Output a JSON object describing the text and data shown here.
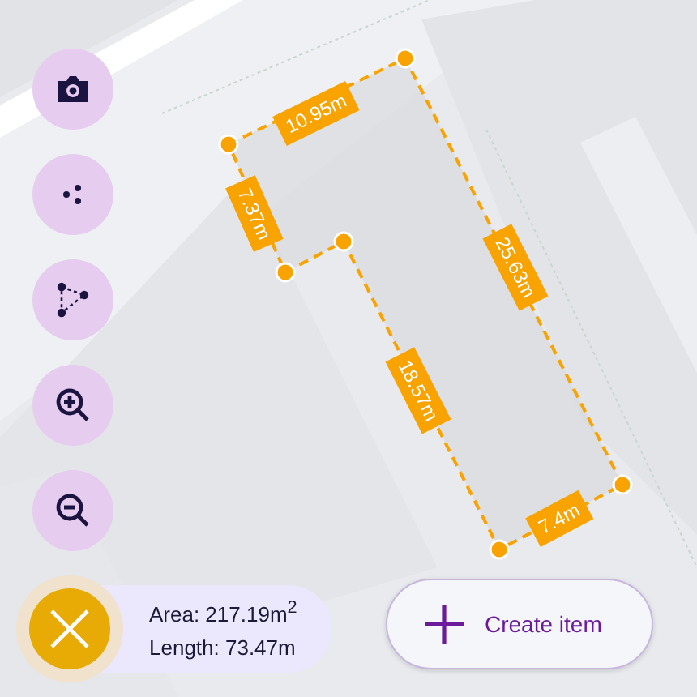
{
  "map_tools": [
    {
      "kind": "camera"
    },
    {
      "kind": "points"
    },
    {
      "kind": "polygon"
    },
    {
      "kind": "zoom_in"
    },
    {
      "kind": "zoom_out"
    }
  ],
  "measurement": {
    "edge_labels": [
      "10.95m",
      "25.63m",
      "7.4m",
      "18.57m",
      "7.37m"
    ]
  },
  "summary": {
    "area": "Area: 217.19m$^{2}$",
    "length": "Length: 73.47m"
  },
  "create_button": {
    "label": "Create item"
  }
}
